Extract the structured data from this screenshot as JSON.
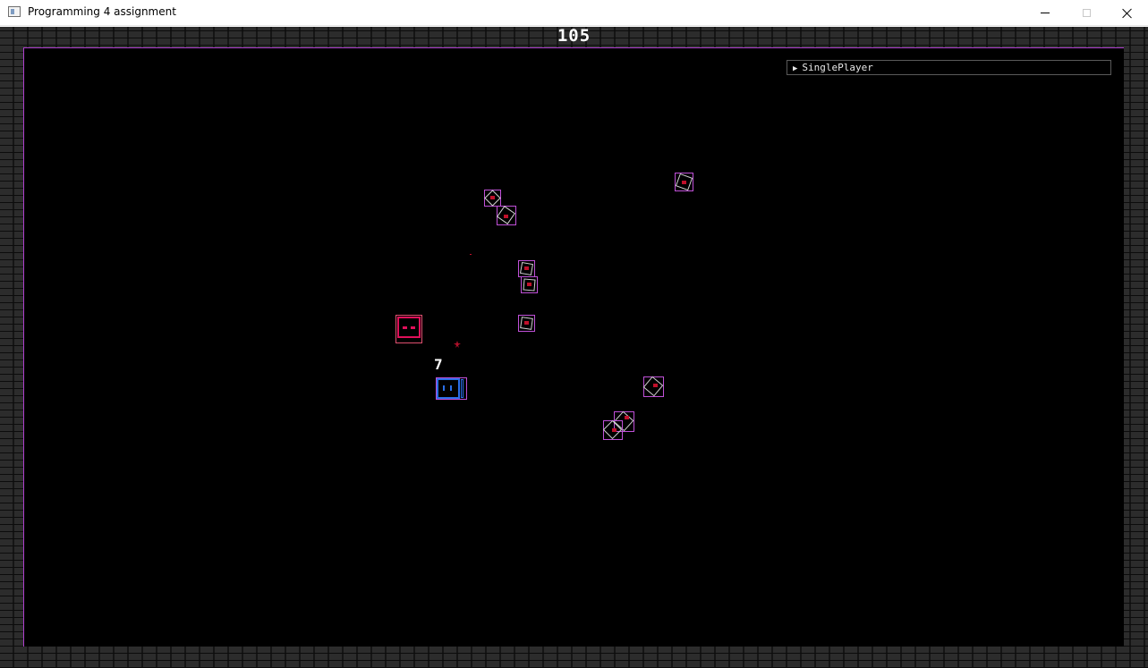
{
  "window": {
    "title": "Programming 4 assignment",
    "controls": [
      "minimize",
      "maximize",
      "close"
    ]
  },
  "hud": {
    "score": "105",
    "lives": "7"
  },
  "menu": {
    "mode_label": "SinglePlayer",
    "expand_icon": "triangle-right-icon"
  },
  "colors": {
    "arena_border": "#b040d0",
    "enemy_outline": "#c050d8",
    "enemy_core": "#c0102a",
    "player_pink": "#e0105a",
    "player_blue": "#2a6ee8",
    "brick_wall": "#2c2c2c"
  },
  "entities": {
    "enemy_count": 10,
    "players": [
      "pink-player",
      "blue-player"
    ]
  }
}
